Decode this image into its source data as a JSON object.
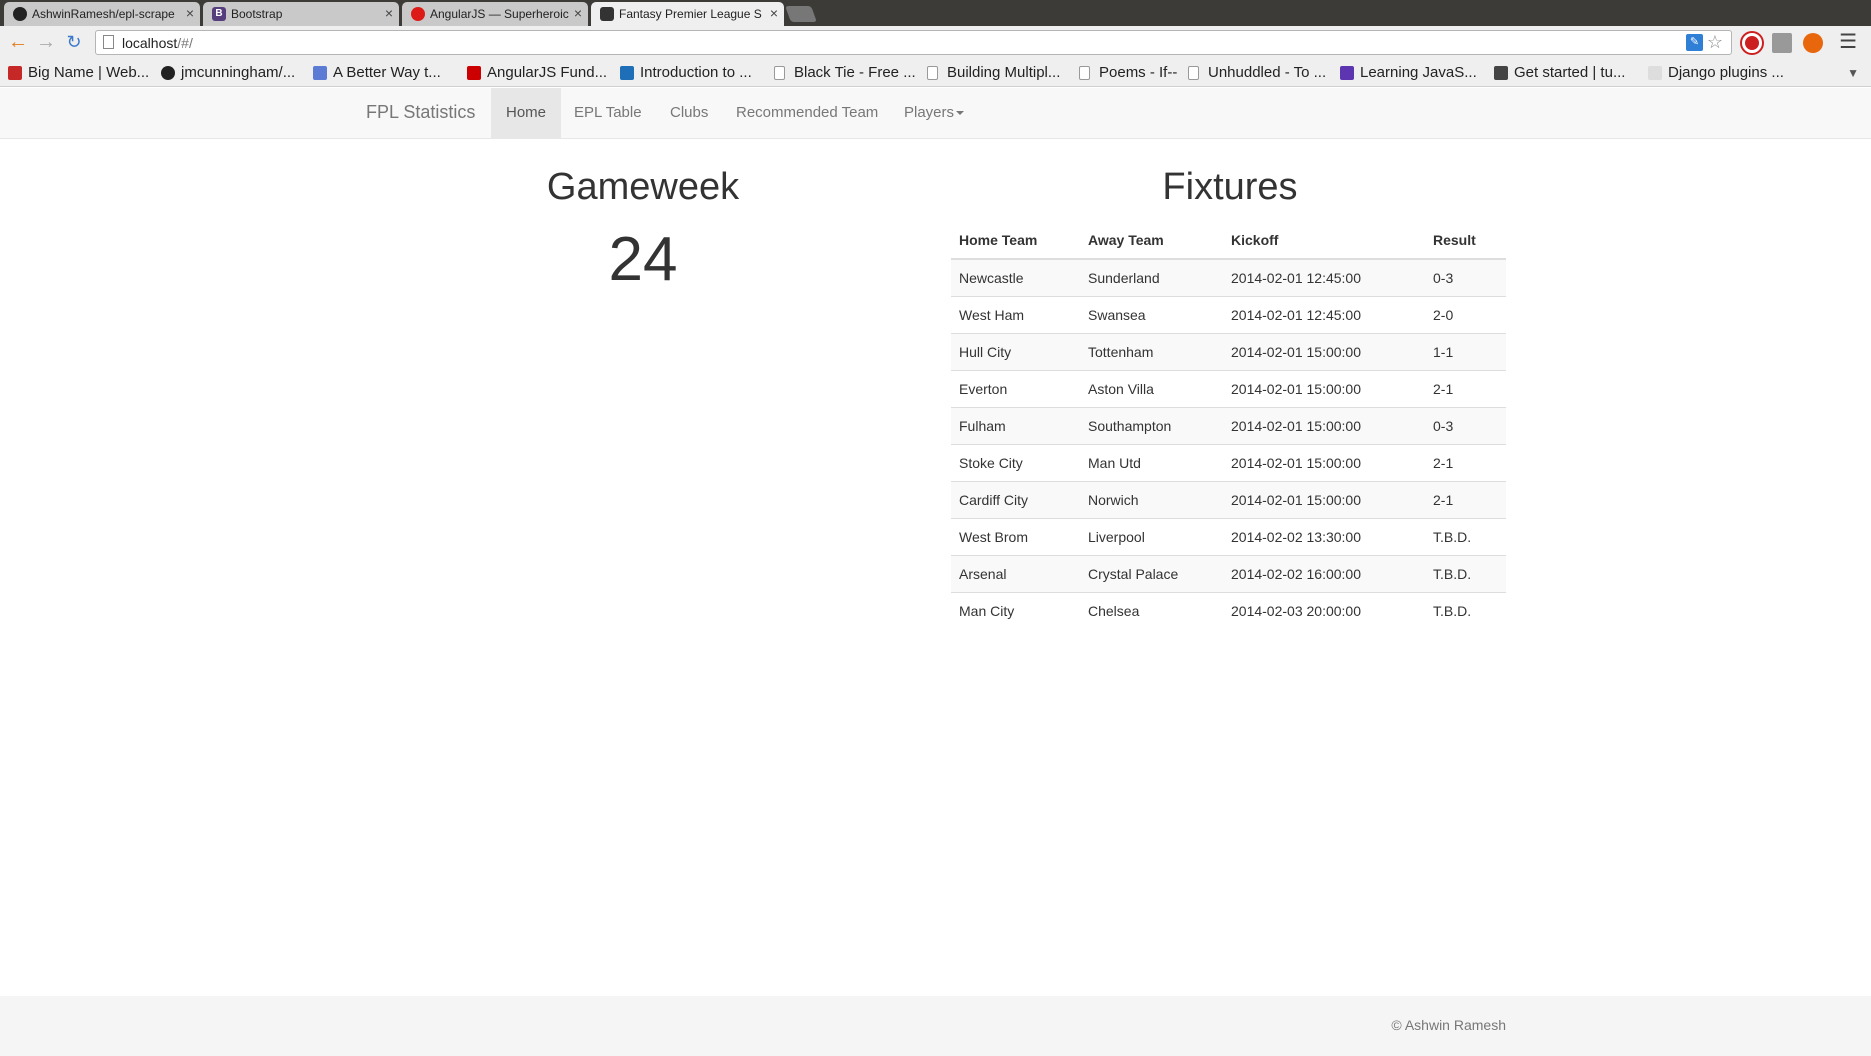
{
  "browser": {
    "tabs": [
      {
        "title": "AshwinRamesh/epl-scrape",
        "icon": "github-icon",
        "color": "#222222"
      },
      {
        "title": "Bootstrap",
        "icon": "bootstrap-icon",
        "color": "#563d7c"
      },
      {
        "title": "AngularJS — Superheroic",
        "icon": "angular-icon",
        "color": "#dd1b16"
      },
      {
        "title": "Fantasy Premier League S",
        "icon": "fpl-icon",
        "color": "#333333"
      }
    ],
    "url_host": "localhost",
    "url_path": "/#/",
    "bookmarks": [
      {
        "label": "Big Name | Web...",
        "icon": "bookmark-icon-bignname",
        "color": "#c62828"
      },
      {
        "label": "jmcunningham/...",
        "icon": "github-icon",
        "color": "#222222"
      },
      {
        "label": "A Better Way t...",
        "icon": "tumblr-icon",
        "color": "#5b7bd5"
      },
      {
        "label": "AngularJS Fund...",
        "icon": "youtube-icon",
        "color": "#cc0000"
      },
      {
        "label": "Introduction to ...",
        "icon": "bookmark-icon-intro",
        "color": "#1e6fb8"
      },
      {
        "label": "Black Tie - Free ...",
        "icon": "page-icon",
        "color": ""
      },
      {
        "label": "Building Multipl...",
        "icon": "page-icon",
        "color": ""
      },
      {
        "label": "Poems - If--",
        "icon": "page-icon",
        "color": ""
      },
      {
        "label": "Unhuddled - To ...",
        "icon": "page-icon",
        "color": ""
      },
      {
        "label": "Learning JavaS...",
        "icon": "bookmark-icon-learning",
        "color": "#5e35b1"
      },
      {
        "label": "Get started | tu...",
        "icon": "bookmark-icon-getstarted",
        "color": "#444444"
      },
      {
        "label": "Django plugins ...",
        "icon": "bookmark-icon-django",
        "color": "#bbbbbb"
      }
    ]
  },
  "navbar": {
    "brand": "FPL Statistics",
    "items": [
      "Home",
      "EPL Table",
      "Clubs",
      "Recommended Team",
      "Players"
    ],
    "active": "Home"
  },
  "gameweek": {
    "title": "Gameweek",
    "number": "24"
  },
  "fixtures": {
    "title": "Fixtures",
    "headers": [
      "Home Team",
      "Away Team",
      "Kickoff",
      "Result"
    ],
    "rows": [
      [
        "Newcastle",
        "Sunderland",
        "2014-02-01 12:45:00",
        "0-3"
      ],
      [
        "West Ham",
        "Swansea",
        "2014-02-01 12:45:00",
        "2-0"
      ],
      [
        "Hull City",
        "Tottenham",
        "2014-02-01 15:00:00",
        "1-1"
      ],
      [
        "Everton",
        "Aston Villa",
        "2014-02-01 15:00:00",
        "2-1"
      ],
      [
        "Fulham",
        "Southampton",
        "2014-02-01 15:00:00",
        "0-3"
      ],
      [
        "Stoke City",
        "Man Utd",
        "2014-02-01 15:00:00",
        "2-1"
      ],
      [
        "Cardiff City",
        "Norwich",
        "2014-02-01 15:00:00",
        "2-1"
      ],
      [
        "West Brom",
        "Liverpool",
        "2014-02-02 13:30:00",
        "T.B.D."
      ],
      [
        "Arsenal",
        "Crystal Palace",
        "2014-02-02 16:00:00",
        "T.B.D."
      ],
      [
        "Man City",
        "Chelsea",
        "2014-02-03 20:00:00",
        "T.B.D."
      ]
    ]
  },
  "footer": {
    "copyright": "© Ashwin Ramesh"
  }
}
